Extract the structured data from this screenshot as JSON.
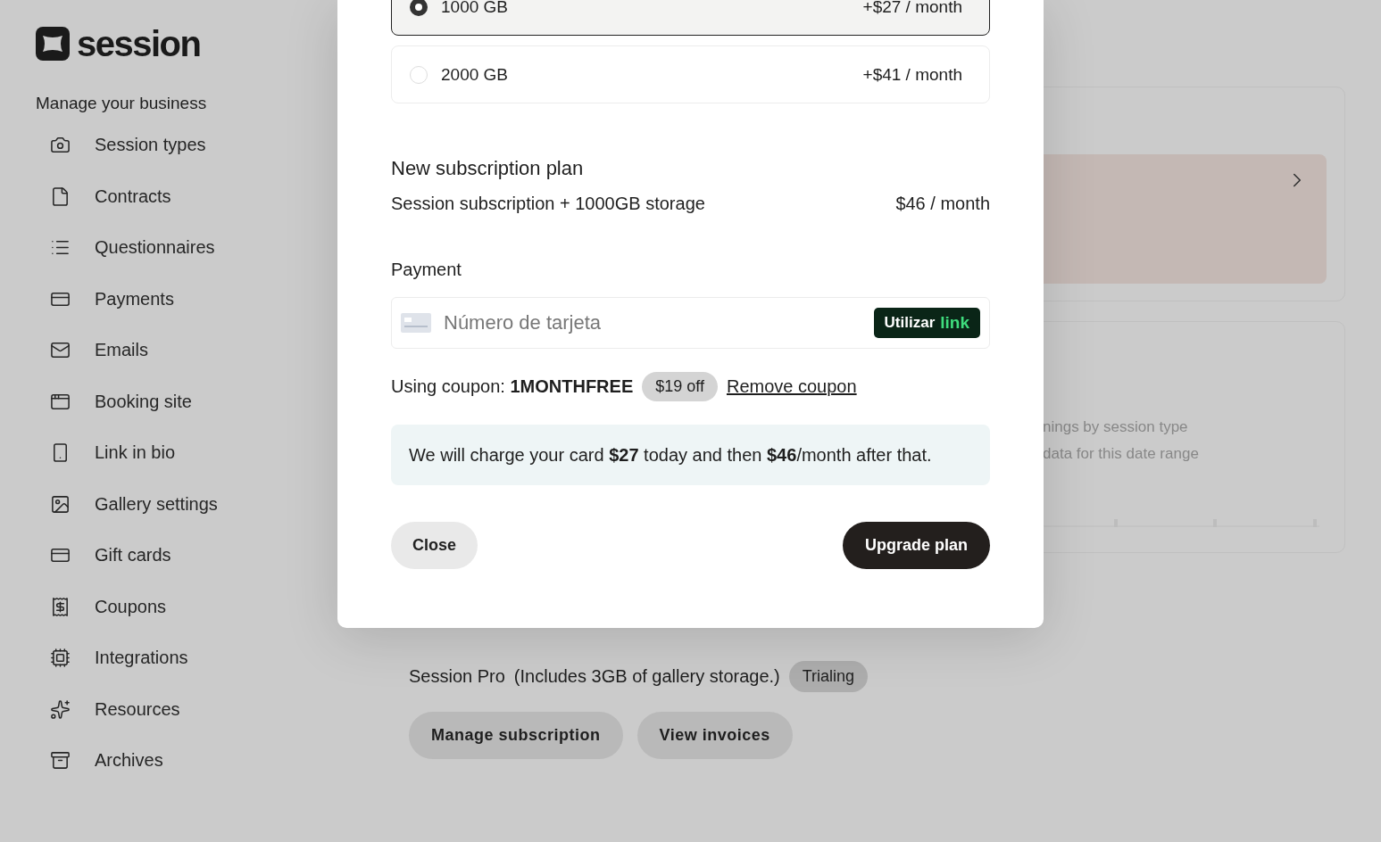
{
  "sidebar": {
    "logo": "session",
    "heading": "Manage your business",
    "items": [
      {
        "label": "Session types"
      },
      {
        "label": "Contracts"
      },
      {
        "label": "Questionnaires"
      },
      {
        "label": "Payments"
      },
      {
        "label": "Emails"
      },
      {
        "label": "Booking site"
      },
      {
        "label": "Link in bio"
      },
      {
        "label": "Gallery settings"
      },
      {
        "label": "Gift cards"
      },
      {
        "label": "Coupons"
      },
      {
        "label": "Integrations"
      },
      {
        "label": "Resources"
      },
      {
        "label": "Archives"
      }
    ]
  },
  "earnings_card": {
    "title": "nings by session type",
    "subtitle": "data for this date range"
  },
  "subscription": {
    "plan": "Session Pro",
    "note": "(Includes 3GB of gallery storage.)",
    "status": "Trialing",
    "buttons": [
      "Manage subscription",
      "View invoices"
    ]
  },
  "modal": {
    "storage_options": [
      {
        "label": "1000 GB",
        "price": "+$27 / month",
        "selected": true
      },
      {
        "label": "2000 GB",
        "price": "+$41 / month",
        "selected": false
      }
    ],
    "plan": {
      "heading": "New subscription plan",
      "name": "Session subscription + 1000GB storage",
      "price": "$46 / month"
    },
    "payment": {
      "heading": "Payment",
      "placeholder": "Número de tarjeta",
      "link_button": {
        "text": "Utilizar",
        "brand": "link"
      }
    },
    "coupon": {
      "label": "Using coupon:",
      "code": "1MONTHFREE",
      "discount": "$19 off",
      "remove": "Remove coupon"
    },
    "notice": "We will charge your card **$27** today and then **$46**/month after that.",
    "buttons": {
      "close": "Close",
      "upgrade": "Upgrade plan"
    }
  }
}
